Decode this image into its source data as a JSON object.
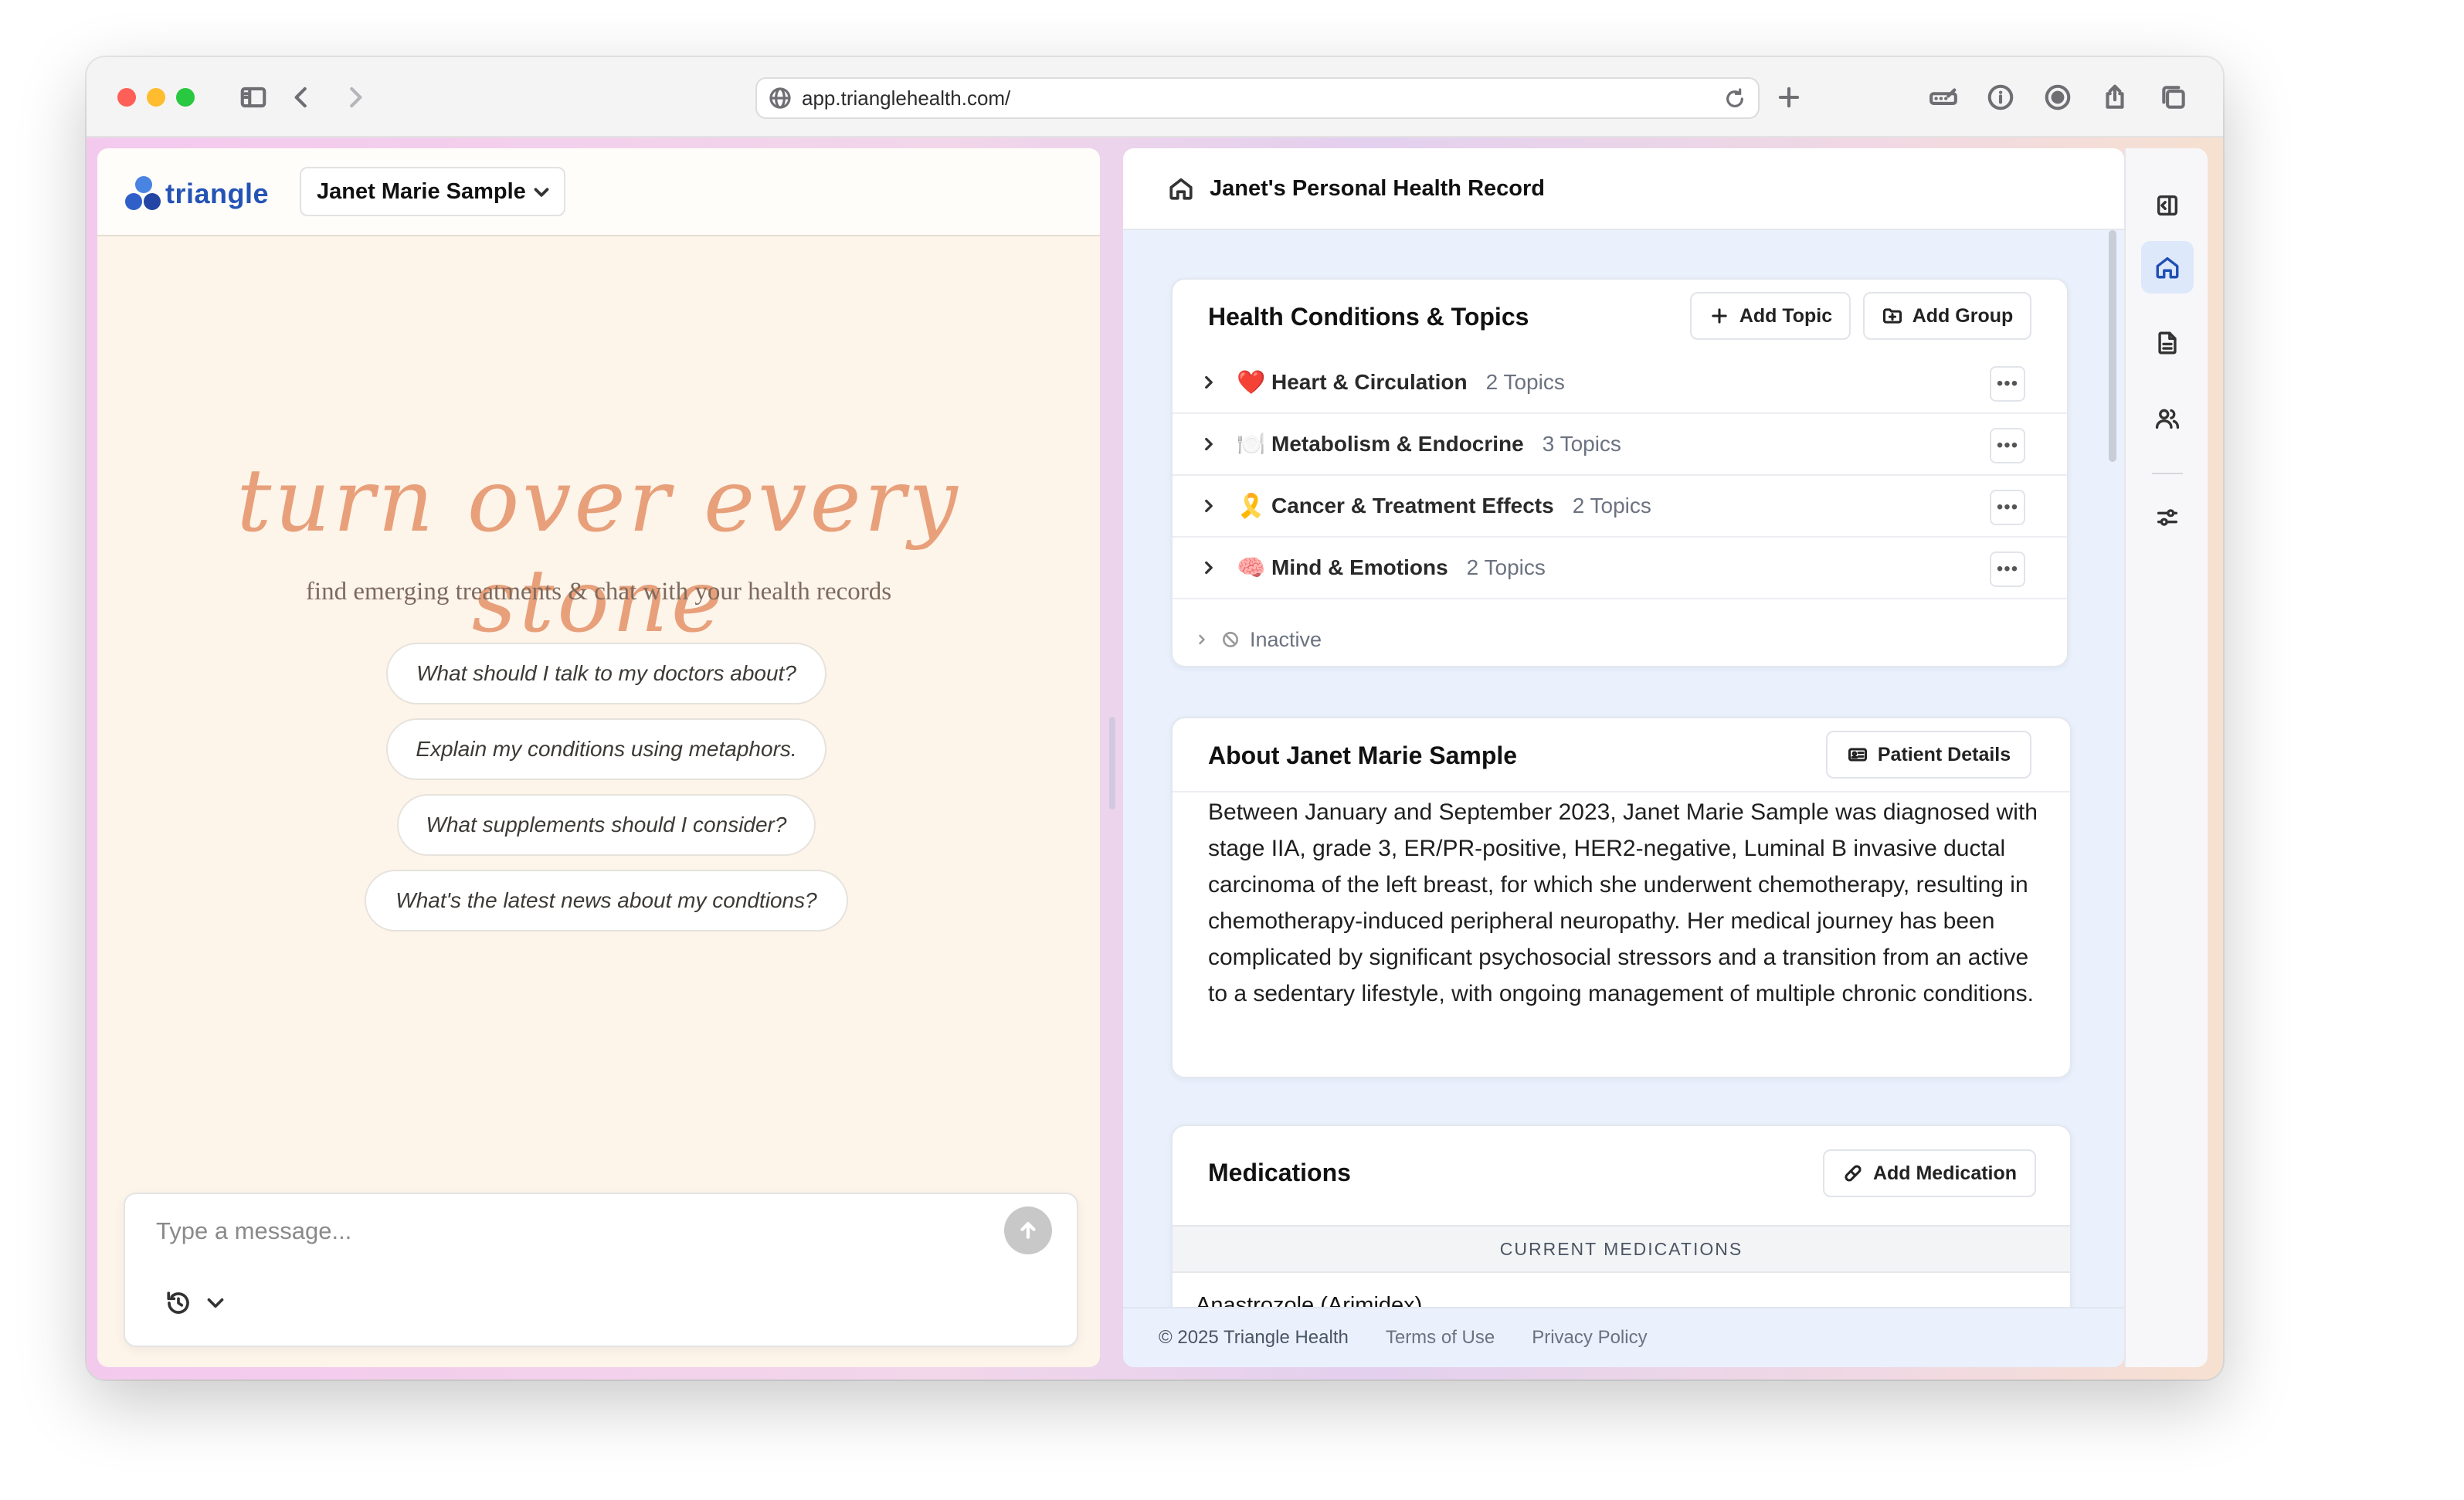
{
  "browser": {
    "url": "app.trianglehealth.com/"
  },
  "chat": {
    "logo_text": "triangle",
    "patient_select": "Janet Marie Sample",
    "hero_title": "turn over every stone",
    "hero_subtitle": "find emerging treatments & chat with your health records",
    "prompts": [
      "What should I talk to my doctors about?",
      "Explain my conditions using metaphors.",
      "What supplements should I consider?",
      "What's the latest news about my condtions?"
    ],
    "composer_placeholder": "Type a message..."
  },
  "record": {
    "title": "Janet's Personal Health Record",
    "conditions": {
      "title": "Health Conditions & Topics",
      "add_topic": "Add Topic",
      "add_group": "Add Group",
      "groups": [
        {
          "emoji": "❤️",
          "name": "Heart & Circulation",
          "count": "2 Topics"
        },
        {
          "emoji": "🍽️",
          "name": "Metabolism & Endocrine",
          "count": "3 Topics"
        },
        {
          "emoji": "🎗️",
          "name": "Cancer & Treatment Effects",
          "count": "2 Topics"
        },
        {
          "emoji": "🧠",
          "name": "Mind & Emotions",
          "count": "2 Topics"
        }
      ],
      "inactive_label": "Inactive"
    },
    "about": {
      "title": "About Janet Marie Sample",
      "details_button": "Patient Details",
      "text": "Between January and September 2023, Janet Marie Sample was diagnosed with stage IIA, grade 3, ER/PR-positive, HER2-negative, Luminal B invasive ductal carcinoma of the left breast, for which she underwent chemotherapy, resulting in chemotherapy-induced peripheral neuropathy. Her medical journey has been complicated by significant psychosocial stressors and a transition from an active to a sedentary lifestyle, with ongoing management of multiple chronic conditions."
    },
    "medications": {
      "title": "Medications",
      "add_button": "Add Medication",
      "section_label": "CURRENT MEDICATIONS",
      "items": [
        {
          "name": "Anastrozole (Arimidex)",
          "active": true
        }
      ]
    },
    "footer": {
      "copyright": "© 2025 Triangle Health",
      "terms": "Terms of Use",
      "privacy": "Privacy Policy"
    }
  },
  "colors": {
    "accent": "#2553b5",
    "hero": "#e8a07a",
    "toggle_on": "#22a05a"
  }
}
